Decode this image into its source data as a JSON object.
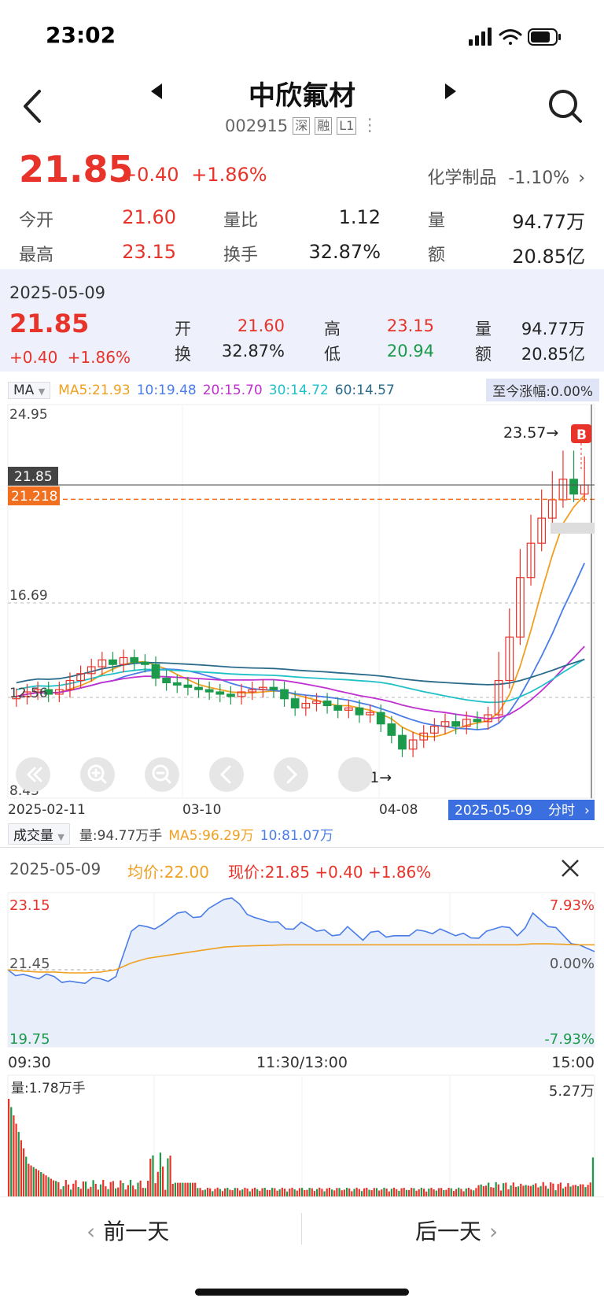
{
  "status": {
    "time": "23:02"
  },
  "header": {
    "name": "中欣氟材",
    "code": "002915",
    "tags": [
      "深",
      "融",
      "L1"
    ]
  },
  "quote": {
    "price": "21.85",
    "change": "+0.40",
    "change_pct": "+1.86%",
    "industry": "化学制品",
    "industry_pct": "-1.10%"
  },
  "stats": [
    [
      {
        "label": "今开",
        "value": "21.60",
        "color": "red"
      },
      {
        "label": "量比",
        "value": "1.12",
        "color": "black"
      },
      {
        "label": "量",
        "value": "94.77万",
        "color": "black"
      }
    ],
    [
      {
        "label": "最高",
        "value": "23.15",
        "color": "red"
      },
      {
        "label": "换手",
        "value": "32.87%",
        "color": "black"
      },
      {
        "label": "额",
        "value": "20.85亿",
        "color": "black"
      }
    ]
  ],
  "day_panel": {
    "date": "2025-05-09",
    "price": "21.85",
    "change": "+0.40",
    "change_pct": "+1.86%",
    "open_label": "开",
    "open": "21.60",
    "high_label": "高",
    "high": "23.15",
    "vol_label": "量",
    "vol": "94.77万",
    "turn_label": "换",
    "turn": "32.87%",
    "low_label": "低",
    "low": "20.94",
    "amt_label": "额",
    "amt": "20.85亿"
  },
  "ma": {
    "select": "MA",
    "ma5": "MA5:21.93",
    "ma10": "10:19.48",
    "ma20": "20:15.70",
    "ma30": "30:14.72",
    "ma60": "60:14.57",
    "since_rise": "至今涨幅:0.00%",
    "colors": {
      "ma5": "#f0a020",
      "ma10": "#4a7de8",
      "ma20": "#c030d0",
      "ma30": "#20c0c8",
      "ma60": "#2a6a8a"
    }
  },
  "kline": {
    "y_max": "24.95",
    "y_mid1": "16.69",
    "y_mid2": "12.56",
    "y_min": "8.43",
    "current_tag": "21.85",
    "avg_tag": "21.218",
    "high_note": "23.57→",
    "low_note": "9.31→",
    "b_mark": "B",
    "x_labels": [
      "2025-02-11",
      "03-10",
      "04-08"
    ],
    "date_tag": "2025-05-09",
    "fenshi": "分时"
  },
  "volume_row": {
    "select": "成交量",
    "vol": "量:94.77万手",
    "ma5": "MA5:96.29万",
    "ma10": "10:81.07万"
  },
  "intraday": {
    "date": "2025-05-09",
    "avg": "均价:22.00",
    "now": "现价:21.85 +0.40 +1.86%",
    "y_top": "23.15",
    "y_mid": "21.45",
    "y_bot": "19.75",
    "pct_top": "7.93%",
    "pct_mid": "0.00%",
    "pct_bot": "-7.93%",
    "x_labels": [
      "09:30",
      "11:30/13:00",
      "15:00"
    ],
    "vol_label": "量:1.78万手",
    "vol_max": "5.27万"
  },
  "chart_data": [
    {
      "type": "candlestick",
      "title": "",
      "x_labels": [
        "2025-02-11",
        "03-10",
        "04-08",
        "2025-05-09"
      ],
      "ylim": [
        8.43,
        24.95
      ],
      "series": [
        {
          "name": "MA5",
          "last": 21.93
        },
        {
          "name": "MA10",
          "last": 19.48
        },
        {
          "name": "MA20",
          "last": 15.7
        },
        {
          "name": "MA30",
          "last": 14.72
        },
        {
          "name": "MA60",
          "last": 14.57
        }
      ],
      "close": [
        12.6,
        12.8,
        12.9,
        12.7,
        12.9,
        13.3,
        13.6,
        13.9,
        14.2,
        14.0,
        14.3,
        14.1,
        14.0,
        13.4,
        13.2,
        13.1,
        13.0,
        12.9,
        12.8,
        12.7,
        12.6,
        12.8,
        12.9,
        13.0,
        12.9,
        12.5,
        12.1,
        12.3,
        12.4,
        12.2,
        12.0,
        12.1,
        11.8,
        11.9,
        11.4,
        10.9,
        10.3,
        10.7,
        11.0,
        11.3,
        11.5,
        11.3,
        11.6,
        11.5,
        11.8,
        13.3,
        15.2,
        17.8,
        19.3,
        20.4,
        21.2,
        22.1,
        21.45,
        21.85
      ],
      "high_note": 23.57,
      "low_note": 9.31,
      "current": 21.85,
      "avg": 21.218
    },
    {
      "type": "line",
      "title": "",
      "x_labels": [
        "09:30",
        "11:30/13:00",
        "15:00"
      ],
      "ylim": [
        19.75,
        23.15
      ],
      "series": [
        {
          "name": "现价",
          "values": [
            21.45,
            21.35,
            21.25,
            21.3,
            21.2,
            21.15,
            21.25,
            21.3,
            22.3,
            22.4,
            22.45,
            22.7,
            22.6,
            22.8,
            23.0,
            22.9,
            22.6,
            22.5,
            22.35,
            22.5,
            22.3,
            22.2,
            22.4,
            22.1,
            22.3,
            22.2,
            22.2,
            22.3,
            22.35,
            22.2,
            22.15,
            22.3,
            22.4,
            22.2,
            22.7,
            22.4,
            22.2,
            22.0,
            21.85
          ]
        },
        {
          "name": "均价",
          "values": [
            21.45,
            21.42,
            21.4,
            21.4,
            21.38,
            21.38,
            21.4,
            21.45,
            21.6,
            21.7,
            21.75,
            21.8,
            21.85,
            21.9,
            21.95,
            21.97,
            21.98,
            21.99,
            22.0,
            22.0,
            22.0,
            22.0,
            22.0,
            22.0,
            22.0,
            22.0,
            22.0,
            22.0,
            22.0,
            22.0,
            22.0,
            22.0,
            22.0,
            22.0,
            22.02,
            22.02,
            22.01,
            22.0,
            22.0
          ]
        }
      ],
      "pct_range": [
        "7.93%",
        "0.00%",
        "-7.93%"
      ],
      "volume_max": "5.27万"
    }
  ],
  "bottom": {
    "prev": "前一天",
    "next": "后一天"
  }
}
